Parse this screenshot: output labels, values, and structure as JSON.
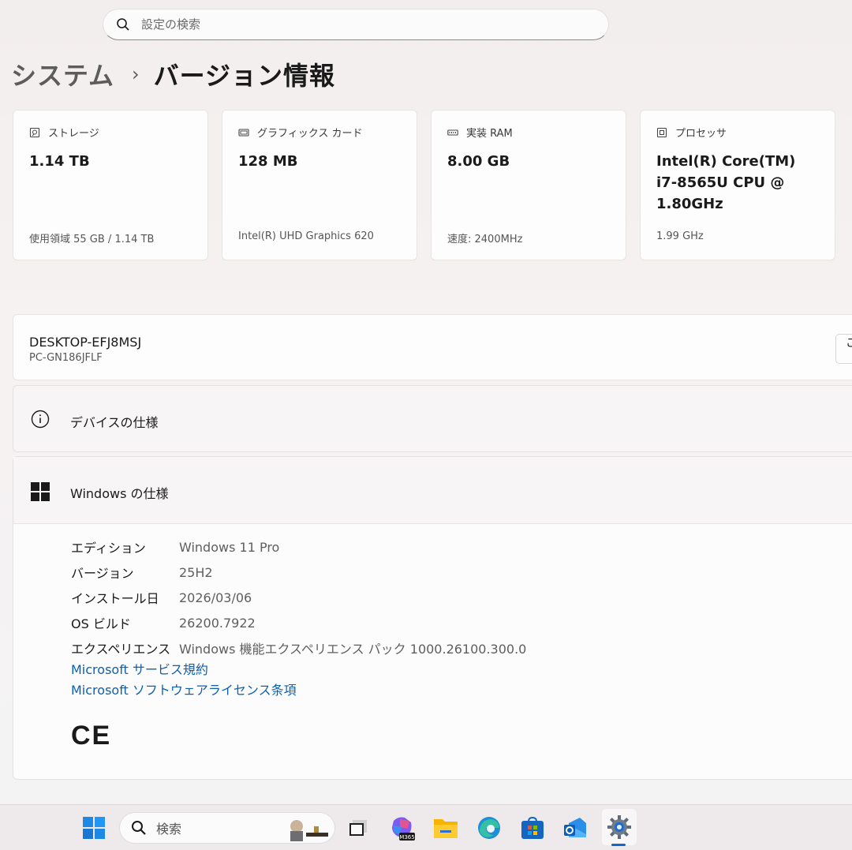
{
  "search": {
    "placeholder": "設定の検索"
  },
  "breadcrumb": {
    "parent": "システム",
    "separator": "›",
    "current": "バージョン情報"
  },
  "cards": [
    {
      "icon": "storage-icon",
      "label": "ストレージ",
      "value": "1.14 TB",
      "sub": "使用領域 55 GB / 1.14 TB"
    },
    {
      "icon": "graphics-card-icon",
      "label": "グラフィックス カード",
      "value": "128 MB",
      "sub": "Intel(R) UHD Graphics 620"
    },
    {
      "icon": "ram-icon",
      "label": "実装 RAM",
      "value": "8.00 GB",
      "sub": "速度: 2400MHz"
    },
    {
      "icon": "processor-icon",
      "label": "プロセッサ",
      "value": "Intel(R) Core(TM)\ni7-8565U CPU @\n1.80GHz",
      "sub": "1.99 GHz"
    }
  ],
  "device": {
    "name": "DESKTOP-EFJ8MSJ",
    "model": "PC-GN186JFLF",
    "rename_label": "こ"
  },
  "device_spec": {
    "title": "デバイスの仕様",
    "icon": "info-icon"
  },
  "windows_spec": {
    "title": "Windows の仕様",
    "icon": "windows-logo-icon",
    "rows": [
      {
        "key": "エディション",
        "value": "Windows 11 Pro"
      },
      {
        "key": "バージョン",
        "value": "25H2"
      },
      {
        "key": "インストール日",
        "value": "2026/03/06"
      },
      {
        "key": "OS ビルド",
        "value": "26200.7922"
      },
      {
        "key": "エクスペリエンス",
        "value": "Windows 機能エクスペリエンス パック 1000.26100.300.0"
      }
    ],
    "links": [
      "Microsoft サービス規約",
      "Microsoft ソフトウェアライセンス条項"
    ],
    "ce_mark": "CE"
  },
  "taskbar": {
    "search_label": "検索",
    "items": [
      "start-icon",
      "search-box",
      "task-view-icon",
      "microsoft-365-copilot-icon",
      "file-explorer-icon",
      "edge-icon",
      "store-icon",
      "outlook-icon",
      "settings-icon"
    ],
    "m365_badge": "M365",
    "active": "settings-icon"
  },
  "colors": {
    "link": "#0d5fb2",
    "accent": "#1268c4"
  }
}
